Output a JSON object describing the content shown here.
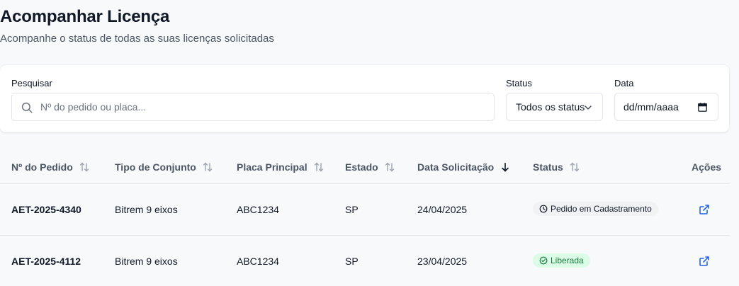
{
  "header": {
    "title": "Acompanhar Licença",
    "subtitle": "Acompanhe o status de todas as suas licenças solicitadas"
  },
  "filters": {
    "search_label": "Pesquisar",
    "search_placeholder": "Nº do pedido ou placa...",
    "search_value": "",
    "status_label": "Status",
    "status_value": "Todos os status",
    "date_label": "Data",
    "date_placeholder": "dd/mm/aaaa"
  },
  "table": {
    "columns": [
      {
        "label": "Nº do Pedido",
        "sort": "none"
      },
      {
        "label": "Tipo de Conjunto",
        "sort": "none"
      },
      {
        "label": "Placa Principal",
        "sort": "none"
      },
      {
        "label": "Estado",
        "sort": "none"
      },
      {
        "label": "Data Solicitação",
        "sort": "desc"
      },
      {
        "label": "Status",
        "sort": "none"
      },
      {
        "label": "Ações"
      }
    ],
    "rows": [
      {
        "pedido": "AET-2025-4340",
        "tipo": "Bitrem 9 eixos",
        "placa": "ABC1234",
        "estado": "SP",
        "data": "24/04/2025",
        "status": "Pedido em Cadastramento",
        "status_icon": "clock-icon",
        "status_color": "#f1f2f4"
      },
      {
        "pedido": "AET-2025-4112",
        "tipo": "Bitrem 9 eixos",
        "placa": "ABC1234",
        "estado": "SP",
        "data": "23/04/2025",
        "status": "Liberada",
        "status_icon": "check-circle-icon",
        "status_color": "#dcfce7"
      }
    ]
  },
  "colors": {
    "accent": "#2563eb",
    "success_text": "#15803d",
    "success_bg": "#dcfce7",
    "neutral_bg": "#f1f2f4"
  }
}
